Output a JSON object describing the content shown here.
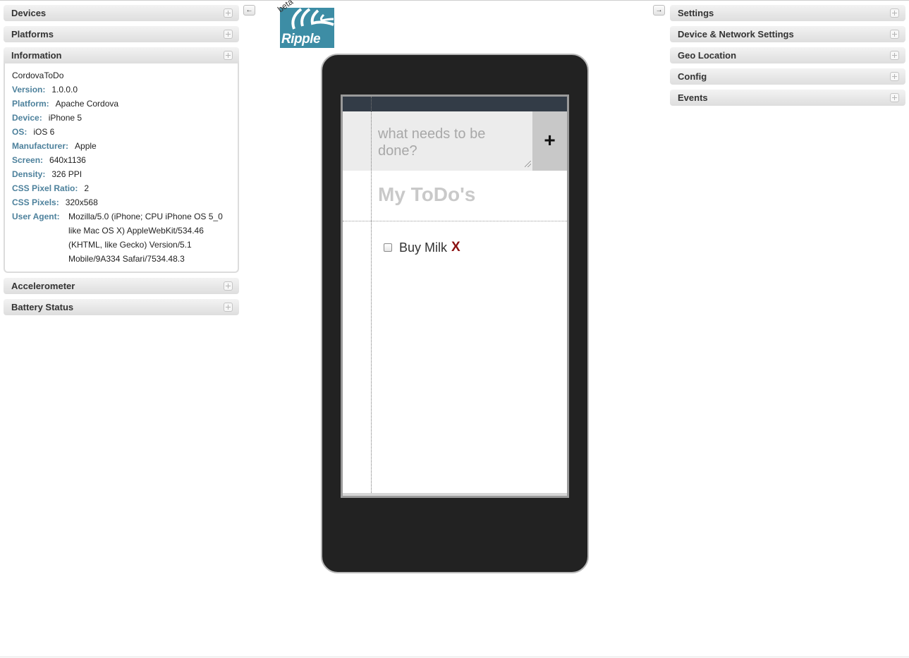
{
  "left_panels": {
    "devices": "Devices",
    "platforms": "Platforms",
    "information": "Information",
    "accelerometer": "Accelerometer",
    "battery": "Battery Status"
  },
  "info": {
    "app_name": "CordovaToDo",
    "rows": [
      {
        "label": "Version:",
        "value": "1.0.0.0"
      },
      {
        "label": "Platform:",
        "value": "Apache Cordova"
      },
      {
        "label": "Device:",
        "value": "iPhone 5"
      },
      {
        "label": "OS:",
        "value": "iOS 6"
      },
      {
        "label": "Manufacturer:",
        "value": "Apple"
      },
      {
        "label": "Screen:",
        "value": "640x1136"
      },
      {
        "label": "Density:",
        "value": "326 PPI"
      },
      {
        "label": "CSS Pixel Ratio:",
        "value": "2"
      },
      {
        "label": "CSS Pixels:",
        "value": "320x568"
      }
    ],
    "user_agent_label": "User Agent:",
    "user_agent": "Mozilla/5.0 (iPhone; CPU iPhone OS 5_0 like Mac OS X) AppleWebKit/534.46 (KHTML, like Gecko) Version/5.1 Mobile/9A334 Safari/7534.48.3"
  },
  "right_panels": {
    "settings": "Settings",
    "device_network": "Device & Network Settings",
    "geo": "Geo Location",
    "config": "Config",
    "events": "Events"
  },
  "logo": {
    "beta": "beta",
    "name": "Ripple"
  },
  "arrows": {
    "left": "←",
    "right": "→"
  },
  "app": {
    "input_placeholder": "what needs to be done?",
    "add_label": "+",
    "list_title": "My ToDo's",
    "items": [
      {
        "text": "Buy Milk",
        "delete": "X"
      }
    ]
  },
  "icons": {
    "expand": "plus-box-icon",
    "collapse_left": "arrow-left-icon",
    "collapse_right": "arrow-right-icon"
  },
  "colors": {
    "label": "#4d819c",
    "status_bar": "#333c47",
    "delete": "#8b1111",
    "logo_bg": "#3d8da5"
  }
}
